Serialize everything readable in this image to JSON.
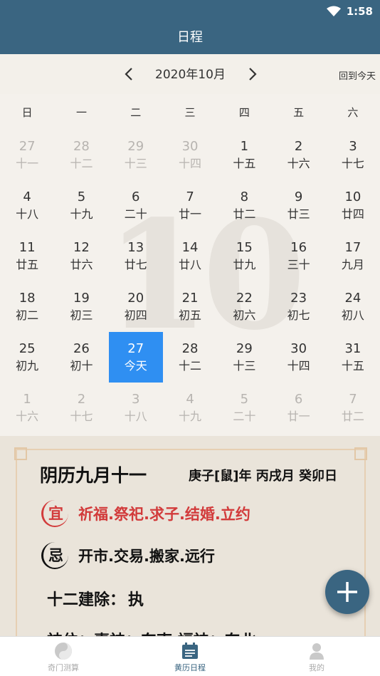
{
  "status": {
    "time": "1:58"
  },
  "header": {
    "title": "日程"
  },
  "monthbar": {
    "month": "2020年10月",
    "today_link": "回到今天"
  },
  "calendar": {
    "watermark": "10",
    "weekdays": [
      "日",
      "一",
      "二",
      "三",
      "四",
      "五",
      "六"
    ],
    "days": [
      {
        "d": "27",
        "l": "十一",
        "m": true
      },
      {
        "d": "28",
        "l": "十二",
        "m": true
      },
      {
        "d": "29",
        "l": "十三",
        "m": true
      },
      {
        "d": "30",
        "l": "十四",
        "m": true
      },
      {
        "d": "1",
        "l": "十五"
      },
      {
        "d": "2",
        "l": "十六"
      },
      {
        "d": "3",
        "l": "十七"
      },
      {
        "d": "4",
        "l": "十八"
      },
      {
        "d": "5",
        "l": "十九"
      },
      {
        "d": "6",
        "l": "二十"
      },
      {
        "d": "7",
        "l": "廿一"
      },
      {
        "d": "8",
        "l": "廿二"
      },
      {
        "d": "9",
        "l": "廿三"
      },
      {
        "d": "10",
        "l": "廿四"
      },
      {
        "d": "11",
        "l": "廿五"
      },
      {
        "d": "12",
        "l": "廿六"
      },
      {
        "d": "13",
        "l": "廿七"
      },
      {
        "d": "14",
        "l": "廿八"
      },
      {
        "d": "15",
        "l": "廿九"
      },
      {
        "d": "16",
        "l": "三十"
      },
      {
        "d": "17",
        "l": "九月"
      },
      {
        "d": "18",
        "l": "初二"
      },
      {
        "d": "19",
        "l": "初三"
      },
      {
        "d": "20",
        "l": "初四"
      },
      {
        "d": "21",
        "l": "初五"
      },
      {
        "d": "22",
        "l": "初六"
      },
      {
        "d": "23",
        "l": "初七"
      },
      {
        "d": "24",
        "l": "初八"
      },
      {
        "d": "25",
        "l": "初九"
      },
      {
        "d": "26",
        "l": "初十"
      },
      {
        "d": "27",
        "l": "今天",
        "t": true
      },
      {
        "d": "28",
        "l": "十二"
      },
      {
        "d": "29",
        "l": "十三"
      },
      {
        "d": "30",
        "l": "十四"
      },
      {
        "d": "31",
        "l": "十五"
      },
      {
        "d": "1",
        "l": "十六",
        "m": true
      },
      {
        "d": "2",
        "l": "十七",
        "m": true
      },
      {
        "d": "3",
        "l": "十八",
        "m": true
      },
      {
        "d": "4",
        "l": "十九",
        "m": true
      },
      {
        "d": "5",
        "l": "二十",
        "m": true
      },
      {
        "d": "6",
        "l": "廿一",
        "m": true
      },
      {
        "d": "7",
        "l": "廿二",
        "m": true
      }
    ]
  },
  "detail": {
    "lunar_date": "阴历九月十一",
    "ganzhi": "庚子[鼠]年 丙戌月 癸卯日",
    "yi_label": "宜",
    "yi_items": "祈福.祭祀.求子.结婚.立约",
    "ji_label": "忌",
    "ji_items": "开市.交易.搬家.远行",
    "jianchu_label": "十二建除：",
    "jianchu_value": "执",
    "cut_line": "神位：喜神：东南  福神：东北"
  },
  "tabs": [
    {
      "label": "奇门测算",
      "icon": "yin-yang-icon"
    },
    {
      "label": "黄历日程",
      "icon": "calendar-icon"
    },
    {
      "label": "我的",
      "icon": "person-icon"
    }
  ],
  "colors": {
    "primary": "#3a6581",
    "today": "#2f8ff2",
    "yi": "#d23b3b"
  }
}
